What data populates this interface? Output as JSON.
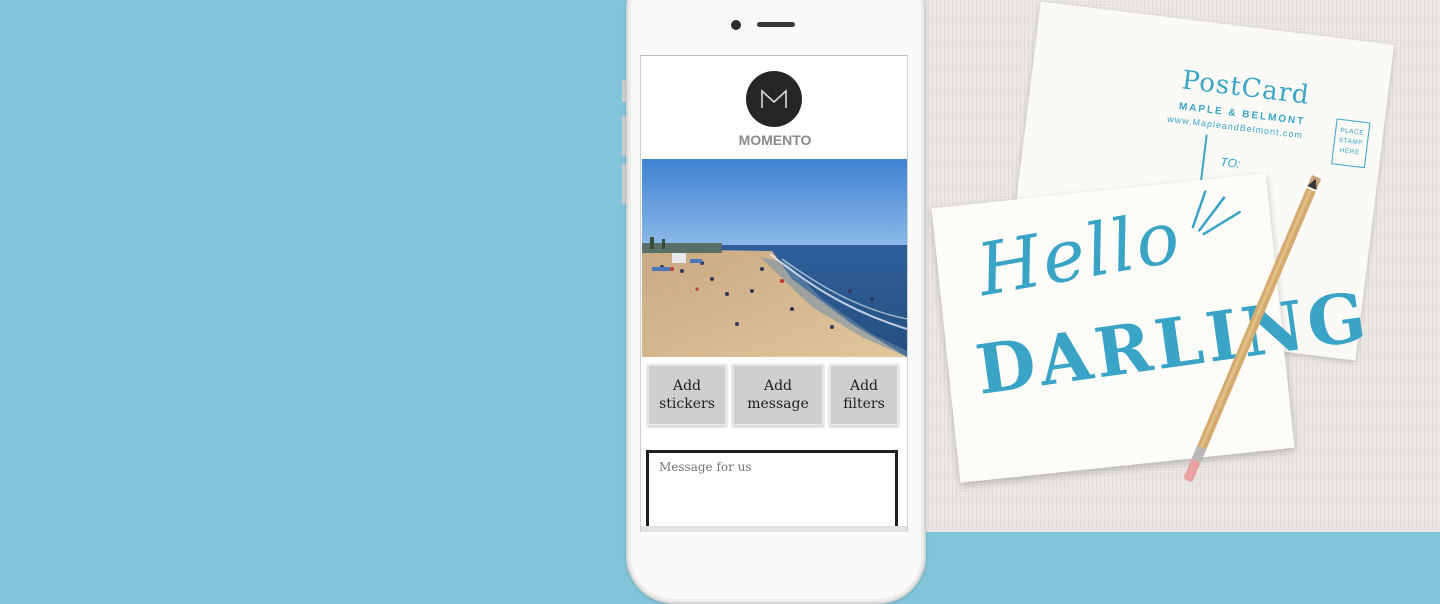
{
  "app": {
    "brand": "MOMENTO",
    "logo_letter": "M"
  },
  "actions": [
    {
      "label": "Add\nstickers"
    },
    {
      "label": "Add\nmessage"
    },
    {
      "label": "Add\nfilters"
    }
  ],
  "message_input": {
    "placeholder": "Message for us",
    "value": ""
  },
  "postcard": {
    "title": "PostCard",
    "brand": "MAPLE & BELMONT",
    "url": "www.MapleandBelmont.com",
    "to_label": "TO:",
    "stamp_text": "PLACE STAMP HERE",
    "front_line1": "Hello",
    "front_line2": "DARLING"
  },
  "colors": {
    "background": "#82c4d9",
    "postcard_ink": "#3aa4c6",
    "button_gray": "#cfcfcf"
  }
}
